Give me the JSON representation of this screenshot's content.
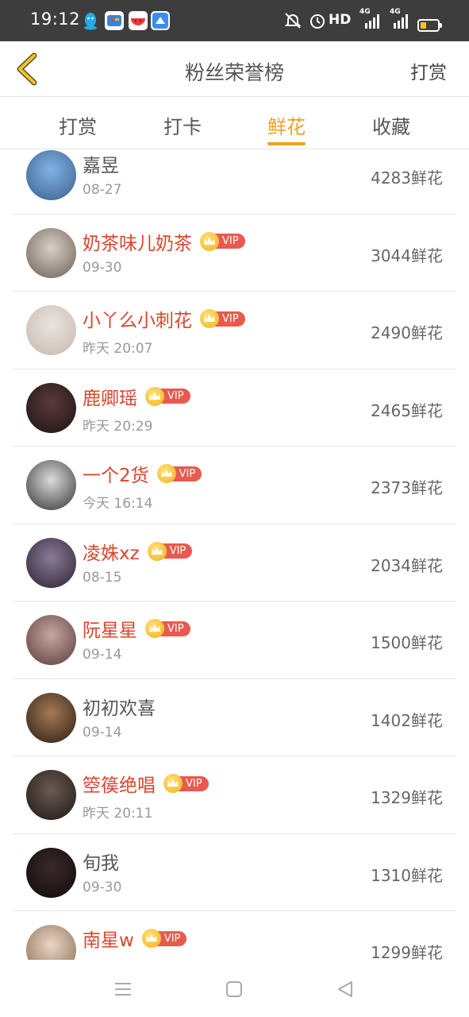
{
  "status_bar": {
    "time": "19:12",
    "hd": "HD",
    "net1": "4G",
    "net2": "4G",
    "icons": [
      "qq-icon",
      "bilibili-icon",
      "watermelon-video-icon",
      "cloud-app-icon",
      "mute-icon",
      "alarm-icon",
      "signal-icon",
      "battery-icon"
    ]
  },
  "header": {
    "title": "粉丝荣誉榜",
    "action": "打赏",
    "accent": "#f0a020"
  },
  "tabs": [
    {
      "label": "打赏",
      "active": false
    },
    {
      "label": "打卡",
      "active": false
    },
    {
      "label": "鲜花",
      "active": true
    },
    {
      "label": "收藏",
      "active": false
    }
  ],
  "list": [
    {
      "name": "嘉昱",
      "date": "08-27",
      "amount": "4283鲜花",
      "vip": false
    },
    {
      "name": "奶茶味儿奶茶",
      "date": "09-30",
      "amount": "3044鲜花",
      "vip": true,
      "vip_label": "VIP"
    },
    {
      "name": "小丫么小刺花",
      "date": "昨天 20:07",
      "amount": "2490鲜花",
      "vip": true,
      "vip_label": "VIP"
    },
    {
      "name": "鹿卿瑶",
      "date": "昨天 20:29",
      "amount": "2465鲜花",
      "vip": true,
      "vip_label": "VIP"
    },
    {
      "name": "一个2货",
      "date": "今天 16:14",
      "amount": "2373鲜花",
      "vip": true,
      "vip_label": "VIP"
    },
    {
      "name": "凌姝xz",
      "date": "08-15",
      "amount": "2034鲜花",
      "vip": true,
      "vip_label": "VIP"
    },
    {
      "name": "阮星星",
      "date": "09-14",
      "amount": "1500鲜花",
      "vip": true,
      "vip_label": "VIP"
    },
    {
      "name": "初初欢喜",
      "date": "09-14",
      "amount": "1402鲜花",
      "vip": false
    },
    {
      "name": "箜篌绝唱",
      "date": "昨天 20:11",
      "amount": "1329鲜花",
      "vip": true,
      "vip_label": "VIP"
    },
    {
      "name": "旬我",
      "date": "09-30",
      "amount": "1310鲜花",
      "vip": false
    },
    {
      "name": "南星w",
      "date": "",
      "amount": "1299鲜花",
      "vip": true,
      "vip_label": "VIP"
    }
  ],
  "colors": {
    "vip_name": "#d9452c",
    "vip_badge": "#e85a4f",
    "crown": "#f2b01e"
  }
}
